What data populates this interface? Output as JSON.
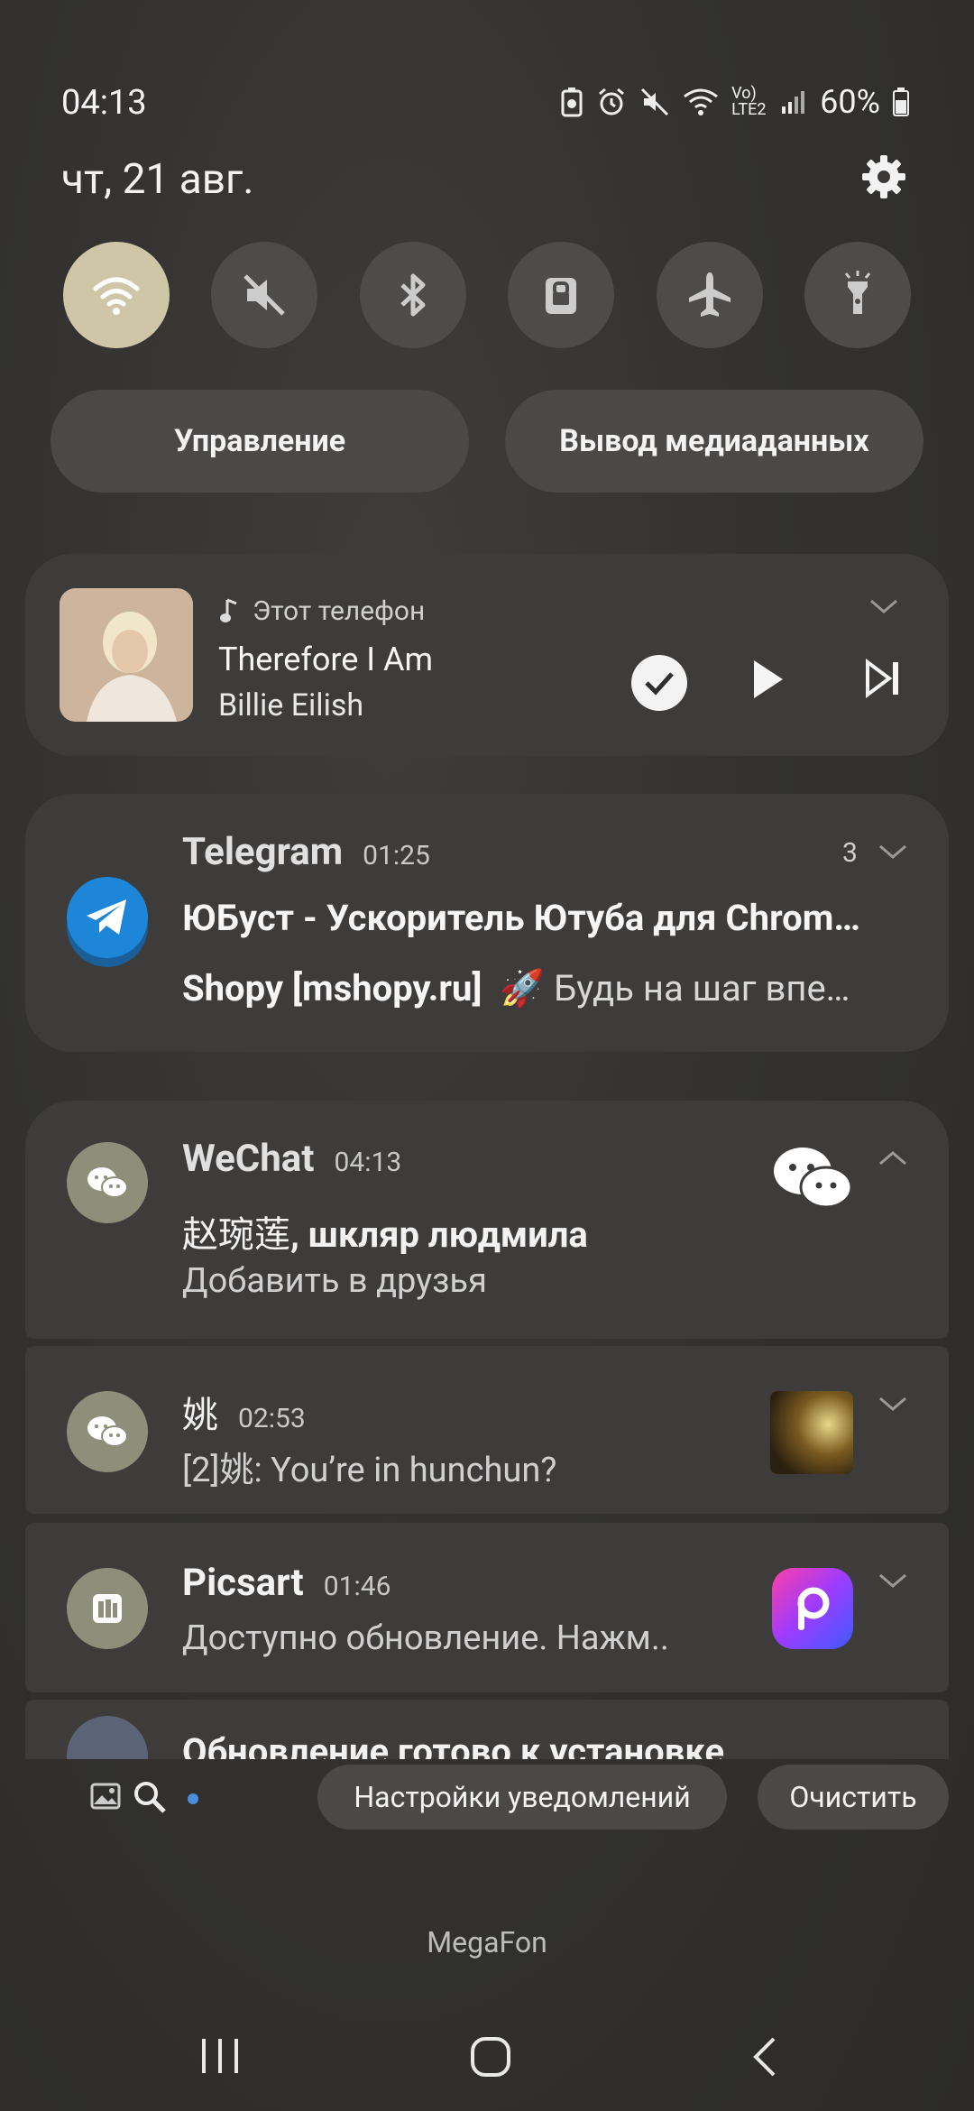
{
  "status": {
    "time": "04:13",
    "network_label": "Vo) LTE2",
    "battery": "60%"
  },
  "header": {
    "date": "чт, 21 авг."
  },
  "quick_toggles": [
    {
      "name": "wifi",
      "active": true
    },
    {
      "name": "sound-mute",
      "active": false
    },
    {
      "name": "bluetooth",
      "active": false
    },
    {
      "name": "screen-lock",
      "active": false
    },
    {
      "name": "airplane",
      "active": false
    },
    {
      "name": "flashlight",
      "active": false
    }
  ],
  "pills": {
    "control": "Управление",
    "media_output": "Вывод медиаданных"
  },
  "media": {
    "source": "Этот телефон",
    "title": "Therefore I Am",
    "artist": "Billie Eilish"
  },
  "telegram": {
    "app": "Telegram",
    "time": "01:25",
    "count": "3",
    "title": "ЮБуст - Ускоритель Ютуба для Chrom…",
    "sender": "Shopy [mshopy.ru]",
    "message": "🚀 Будь на шаг впе…"
  },
  "wechat": {
    "app": "WeChat",
    "time": "04:13",
    "names_cn": "赵琬莲",
    "names_ru": ", шкляр людмила",
    "message": "Добавить в друзья"
  },
  "yao": {
    "name": "姚",
    "time": "02:53",
    "message": "[2]姚: You’re in hunchun?"
  },
  "picsart": {
    "app": "Picsart",
    "time": "01:46",
    "message": "Доступно обновление. Нажм.."
  },
  "update": {
    "text": "Обновление готово к установке"
  },
  "footer": {
    "notif_settings": "Настройки уведомлений",
    "clear": "Очистить"
  },
  "carrier": "MegaFon",
  "colors": {
    "accent_toggle": "#cfc6a8",
    "telegram": "#1e86d8",
    "wechat_icon_bg": "#8d8f7a"
  }
}
